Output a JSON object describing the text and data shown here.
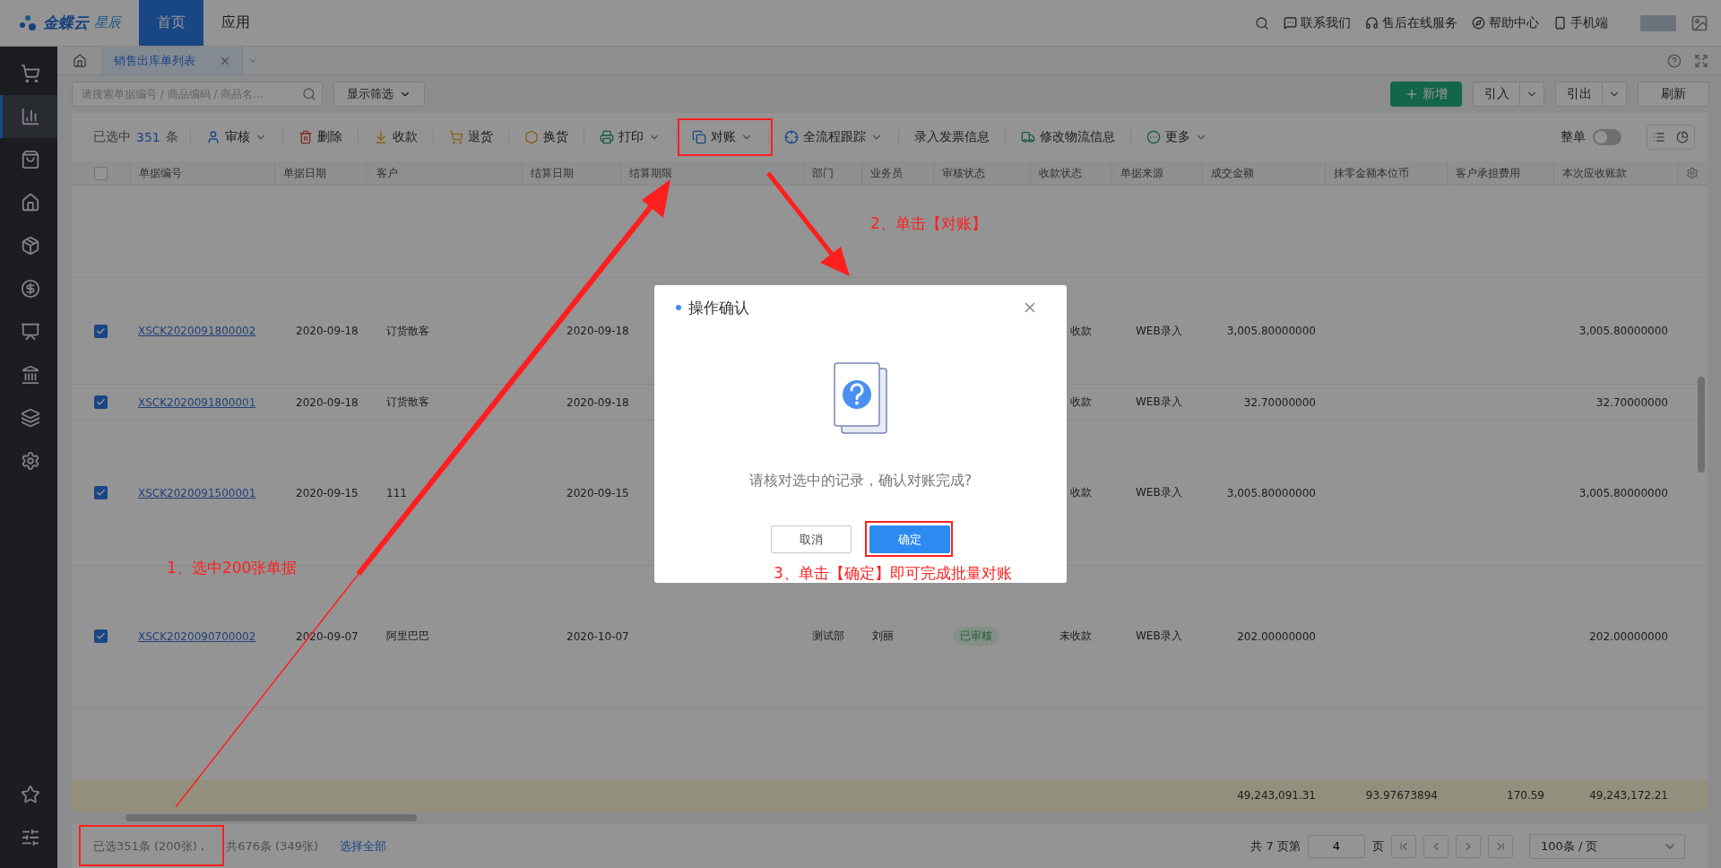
{
  "top_bar": {
    "logo": {
      "name": "金蝶云",
      "edition": "星辰"
    },
    "nav": [
      {
        "label": "首页",
        "selected": true
      },
      {
        "label": "应用",
        "selected": false
      }
    ],
    "links": [
      "联系我们",
      "售后在线服务",
      "帮助中心",
      "手机端"
    ]
  },
  "sidebar": {
    "items": [
      {
        "selected": false
      },
      {
        "selected": true
      },
      {
        "selected": false
      },
      {
        "selected": false
      },
      {
        "selected": false
      },
      {
        "selected": false
      },
      {
        "selected": false
      },
      {
        "selected": false
      },
      {
        "selected": false
      },
      {
        "selected": false
      }
    ],
    "bottom_items": [
      {
        "selected": false
      },
      {
        "selected": false
      }
    ]
  },
  "page_tabs": [
    {
      "label": "销售出库单列表",
      "selected": true
    }
  ],
  "search": {
    "placeholder": "请搜索单据编号 / 商品编码 / 商品名..."
  },
  "filter_button": "显示筛选",
  "actions": [
    {
      "label": "新增",
      "kind": "primary"
    },
    {
      "label": "引入",
      "kind": "split"
    },
    {
      "label": "引出",
      "kind": "split"
    },
    {
      "label": "刷新",
      "kind": "plain"
    }
  ],
  "toolbar": {
    "selection": {
      "prefix": "已选中",
      "count": "351",
      "suffix": "条"
    },
    "buttons": [
      {
        "label": "审核",
        "dropdown": true
      },
      {
        "label": "删除",
        "dropdown": false
      },
      {
        "label": "收款",
        "dropdown": false
      },
      {
        "label": "退货",
        "dropdown": false
      },
      {
        "label": "换货",
        "dropdown": false
      },
      {
        "label": "打印",
        "dropdown": true
      },
      {
        "label": "对账",
        "dropdown": true
      },
      {
        "label": "全流程跟踪",
        "dropdown": true
      },
      {
        "label": "录入发票信息",
        "dropdown": false
      },
      {
        "label": "修改物流信息",
        "dropdown": false
      },
      {
        "label": "更多",
        "dropdown": true
      }
    ],
    "whole_order": {
      "label": "整单",
      "on": false
    }
  },
  "table": {
    "header_checked": false,
    "columns": [
      {
        "label": "单据编号",
        "kind": "link"
      },
      {
        "label": "单据日期",
        "kind": "date"
      },
      {
        "label": "客户",
        "kind": "text"
      },
      {
        "label": "结算日期",
        "kind": "date"
      },
      {
        "label": "结算期限",
        "kind": "text"
      },
      {
        "label": "部门",
        "kind": "text"
      },
      {
        "label": "业务员",
        "kind": "text"
      },
      {
        "label": "审核状态",
        "kind": "tag"
      },
      {
        "label": "收款状态",
        "kind": "status"
      },
      {
        "label": "单据来源",
        "kind": "text"
      },
      {
        "label": "成交金额",
        "kind": "amount"
      },
      {
        "label": "抹零金额本位币",
        "kind": "amount"
      },
      {
        "label": "客户承担费用",
        "kind": "amount"
      },
      {
        "label": "本次应收账款",
        "kind": "amount"
      }
    ],
    "rows": [
      {
        "selected": true,
        "cells": [
          "XSCK2020091800002",
          "2020-09-18",
          "订货散客",
          "2020-09-18",
          "",
          "",
          "",
          "",
          "收款",
          "WEB录入",
          "3,005.80000000",
          "",
          "",
          "3,005.80000000"
        ]
      },
      {
        "selected": true,
        "cells": [
          "XSCK2020091800001",
          "2020-09-18",
          "订货散客",
          "2020-09-18",
          "",
          "",
          "",
          "",
          "收款",
          "WEB录入",
          "32.70000000",
          "",
          "",
          "32.70000000"
        ]
      },
      {
        "selected": true,
        "cells": [
          "XSCK2020091500001",
          "2020-09-15",
          "111",
          "2020-09-15",
          "",
          "",
          "",
          "",
          "收款",
          "WEB录入",
          "3,005.80000000",
          "",
          "",
          "3,005.80000000"
        ]
      },
      {
        "selected": true,
        "cells": [
          "XSCK2020090700002",
          "2020-09-07",
          "阿里巴巴",
          "2020-10-07",
          "",
          "测试部",
          "刘丽",
          "已审核",
          "未收款",
          "WEB录入",
          "202.00000000",
          "",
          "",
          "202.00000000"
        ]
      }
    ],
    "totals": [
      {
        "value": "49,243,091.31"
      },
      {
        "value": "93.97673894"
      },
      {
        "value": "170.59"
      },
      {
        "value": "49,243,172.21"
      }
    ]
  },
  "footer": {
    "selected": "已选351条 (200张) ,",
    "total": "共676条 (349张)",
    "select_all": "选择全部",
    "pages_prefix": "共 7 页第",
    "page": "4",
    "page_suffix": "页",
    "page_size": "100条 / 页"
  },
  "dialog": {
    "title": "操作确认",
    "message": "请核对选中的记录，确认对账完成?",
    "buttons": [
      {
        "label": "取消",
        "kind": "default"
      },
      {
        "label": "确定",
        "kind": "primary"
      }
    ]
  },
  "annotations": [
    {
      "text": "1、选中200张单据"
    },
    {
      "text": "2、单击【对账】"
    },
    {
      "text": "3、单击【确定】即可完成批量对账"
    }
  ]
}
